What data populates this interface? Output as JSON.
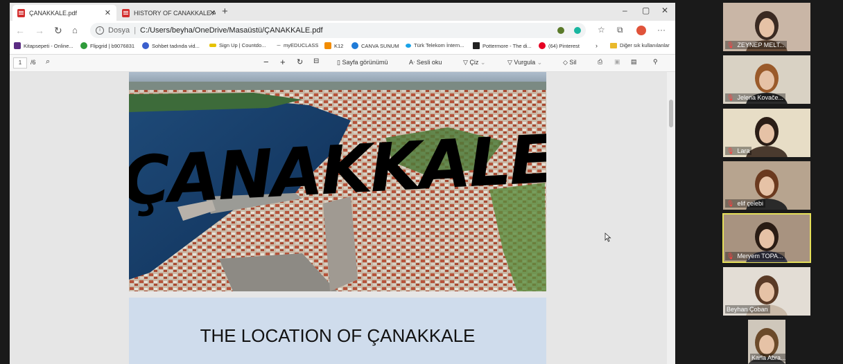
{
  "browser": {
    "tabs": [
      {
        "title": "ÇANAKKALE.pdf",
        "active": true
      },
      {
        "title": "HISTORY OF CANAKKALE AYŞE...",
        "active": false
      }
    ],
    "window_controls": {
      "minimize": "–",
      "maximize": "▢",
      "close": "✕"
    },
    "address": {
      "scheme": "Dosya",
      "path": "C:/Users/beyha/OneDrive/Masaüstü/ÇANAKKALE.pdf"
    },
    "bookmarks": [
      {
        "label": "Kitapsepeti - Online...",
        "color": "#5b2c83"
      },
      {
        "label": "Flipgrid | b9076831",
        "color": "#2e9b3a"
      },
      {
        "label": "Sohbet tadında vid...",
        "color": "#3a5fcd"
      },
      {
        "label": "Sign Up | Countdo...",
        "color": "#e6c200"
      },
      {
        "label": "myEDUCLASS",
        "color": "#999999"
      },
      {
        "label": "K12",
        "color": "#f28c00"
      },
      {
        "label": "CANVA SUNUM",
        "color": "#1f7bd8"
      },
      {
        "label": "Türk Telekom İntern...",
        "color": "#1aa3e8"
      },
      {
        "label": "Pottermore - The di...",
        "color": "#222222"
      },
      {
        "label": "(64) Pinterest",
        "color": "#e60023"
      },
      {
        "label": "Diğer sık kullanılanlar",
        "color": "#e9b92b"
      }
    ]
  },
  "pdf_toolbar": {
    "page_current": "1",
    "page_total": "/6",
    "page_view": "Sayfa görünümü",
    "read_aloud": "Sesli oku",
    "draw": "Çiz",
    "highlight": "Vurgula",
    "erase": "Sil"
  },
  "document": {
    "cover_title": "ÇANAKKALE",
    "slide2_title": "THE LOCATION OF ÇANAKKALE"
  },
  "participants": [
    {
      "name": "ZEYNEP MELT...",
      "bg": "#c9b6a6",
      "hair": "#3a2a22",
      "shirt": "#6b4f3a",
      "speaking": false
    },
    {
      "name": "Jelena Kovače...",
      "bg": "#d9d2c4",
      "hair": "#9a5a2a",
      "shirt": "#2b2b2b",
      "speaking": false
    },
    {
      "name": "Lara",
      "bg": "#e7ddc6",
      "hair": "#2a1d16",
      "shirt": "#4a3a2e",
      "speaking": false
    },
    {
      "name": "elif çelebi",
      "bg": "#b7a48f",
      "hair": "#6b3a1f",
      "shirt": "#2a2a2a",
      "speaking": false
    },
    {
      "name": "Meryem TOPA...",
      "bg": "#a89380",
      "hair": "#2a1c14",
      "shirt": "#3a3a4a",
      "speaking": true
    },
    {
      "name": "Beyhan Çoban",
      "bg": "#e3ddd5",
      "hair": "#5a3a26",
      "shirt": "#c9b9a8",
      "speaking": false
    },
    {
      "name": "Karla Abra...",
      "bg": "#cfc7bb",
      "hair": "#6b4a2a",
      "shirt": "#3c3c3c",
      "speaking": false
    }
  ]
}
